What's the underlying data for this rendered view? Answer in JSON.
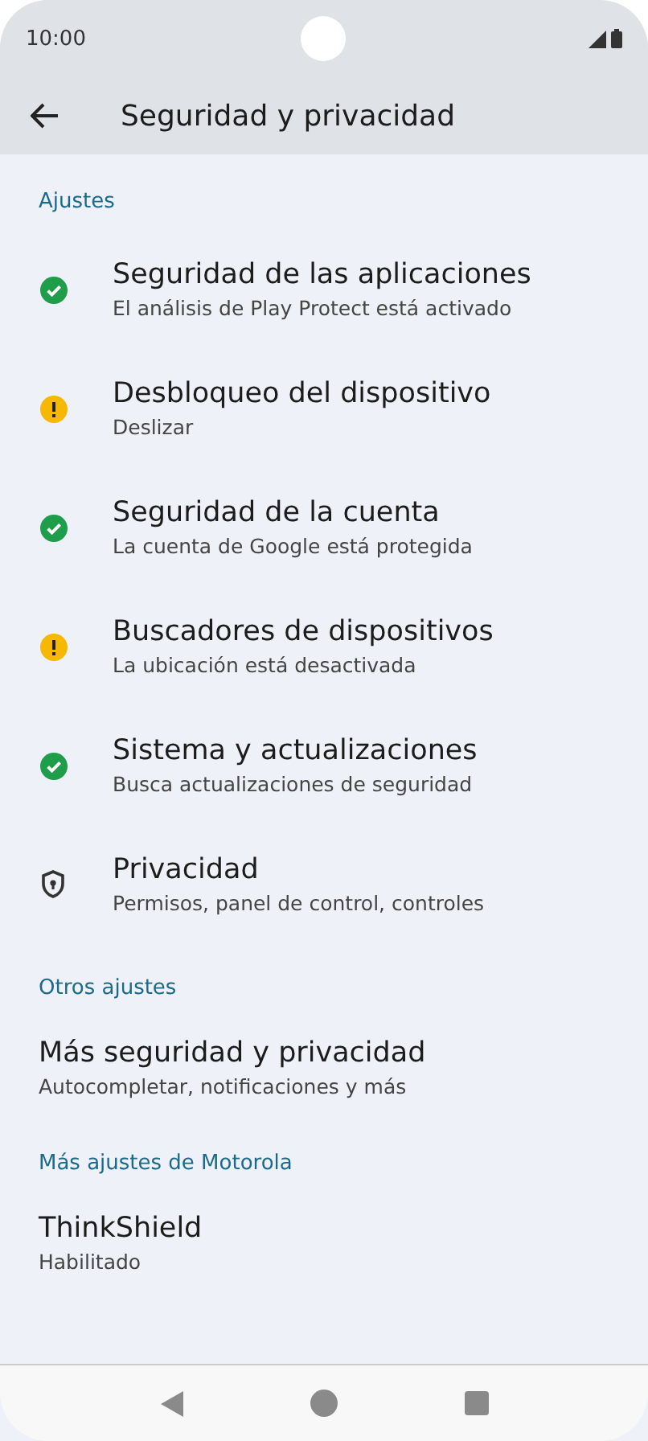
{
  "status_bar": {
    "time": "10:00"
  },
  "app_bar": {
    "title": "Seguridad y privacidad"
  },
  "sections": [
    {
      "header": "Ajustes",
      "items": [
        {
          "title": "Seguridad de las aplicaciones",
          "subtitle": "El análisis de Play Protect está activado",
          "kind": "ok"
        },
        {
          "title": "Desbloqueo del dispositivo",
          "subtitle": "Deslizar",
          "kind": "warning"
        },
        {
          "title": "Seguridad de la cuenta",
          "subtitle": "La cuenta de Google está protegida",
          "kind": "ok"
        },
        {
          "title": "Buscadores de dispositivos",
          "subtitle": "La ubicación está desactivada",
          "kind": "warning"
        },
        {
          "title": "Sistema y actualizaciones",
          "subtitle": "Busca actualizaciones de seguridad",
          "kind": "ok"
        },
        {
          "title": "Privacidad",
          "subtitle": "Permisos, panel de control, controles",
          "kind": "shield"
        }
      ]
    },
    {
      "header": "Otros ajustes",
      "items": [
        {
          "title": "Más seguridad y privacidad",
          "subtitle": "Autocompletar, notificaciones y más"
        }
      ]
    },
    {
      "header": "Más ajustes de Motorola",
      "items": [
        {
          "title": "ThinkShield",
          "subtitle": "Habilitado"
        }
      ]
    }
  ]
}
